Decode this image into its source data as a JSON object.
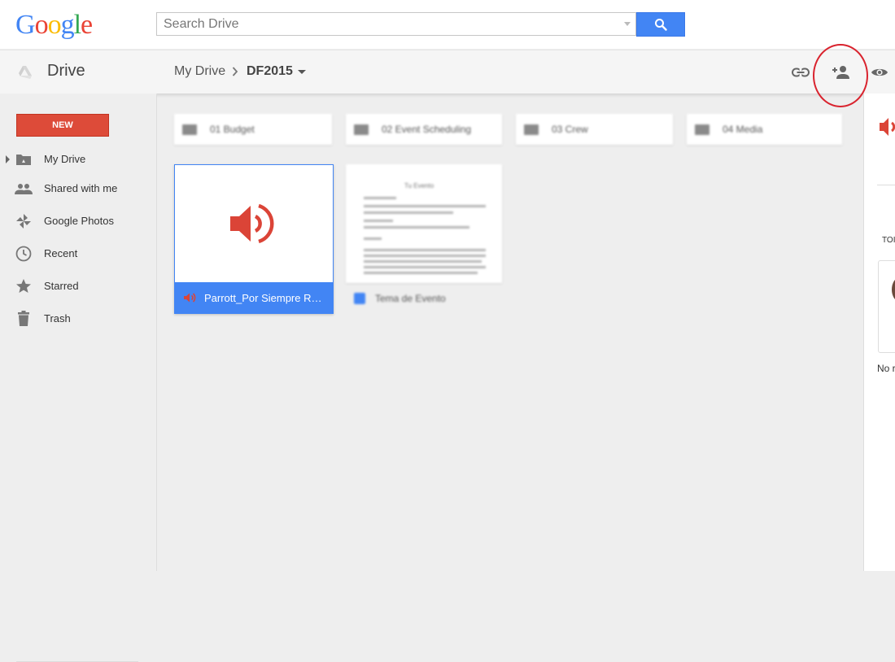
{
  "header": {
    "logo_letters": [
      {
        "char": "G",
        "color": "#4285f4"
      },
      {
        "char": "o",
        "color": "#ea4335"
      },
      {
        "char": "o",
        "color": "#fbbc05"
      },
      {
        "char": "g",
        "color": "#4285f4"
      },
      {
        "char": "l",
        "color": "#34a853"
      },
      {
        "char": "e",
        "color": "#ea4335"
      }
    ],
    "search_placeholder": "Search Drive",
    "search_button_icon": "search-icon"
  },
  "toolbar": {
    "app_name": "Drive",
    "breadcrumb": {
      "root": "My Drive",
      "separator": ">",
      "current": "DF2015"
    },
    "icons": [
      "link-icon",
      "add-person-icon",
      "eye-icon"
    ]
  },
  "sidebar": {
    "new_button": "NEW",
    "items": [
      {
        "label": "My Drive",
        "icon": "drive-folder-icon",
        "expandable": true
      },
      {
        "label": "Shared with me",
        "icon": "people-icon"
      },
      {
        "label": "Google Photos",
        "icon": "pinwheel-icon"
      },
      {
        "label": "Recent",
        "icon": "clock-icon"
      },
      {
        "label": "Starred",
        "icon": "star-icon"
      },
      {
        "label": "Trash",
        "icon": "trash-icon"
      }
    ]
  },
  "main": {
    "folders": [
      {
        "name": "01 Budget"
      },
      {
        "name": "02 Event Scheduling"
      },
      {
        "name": "03 Crew"
      },
      {
        "name": "04 Media"
      }
    ],
    "files": [
      {
        "name": "Parrott_Por Siempre Rey...",
        "type": "audio",
        "icon": "speaker-icon",
        "selected": true
      },
      {
        "name": "Tema de Evento",
        "type": "document",
        "icon": "doc-icon",
        "doc_heading": "Tu Evento"
      }
    ]
  },
  "right_panel": {
    "section_label": "TOI",
    "footer_text": "No r"
  },
  "colors": {
    "accent_blue": "#4285f4",
    "new_button_red": "#dd4b39",
    "audio_red": "#db4437",
    "highlight_ring": "#d9232e"
  }
}
